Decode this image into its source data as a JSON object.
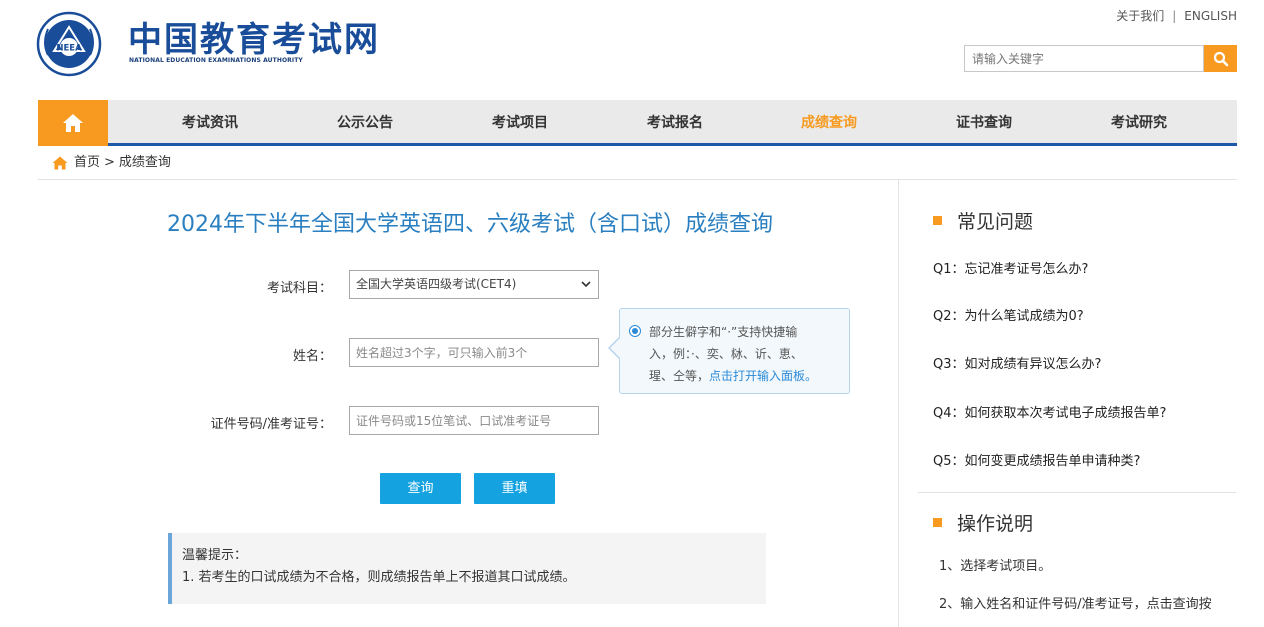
{
  "header": {
    "logo_text_cn": "中国教育考试网",
    "logo_text_en": "NATIONAL EDUCATION EXAMINATIONS AUTHORITY",
    "logo_emblem_text": "NEEA",
    "top_links": [
      "关于我们",
      "ENGLISH"
    ],
    "top_links_separator": "|",
    "search_placeholder": "请输入关键字"
  },
  "nav": {
    "items": [
      {
        "label": "考试资讯"
      },
      {
        "label": "公示公告"
      },
      {
        "label": "考试项目"
      },
      {
        "label": "考试报名"
      },
      {
        "label": "成绩查询",
        "active": true
      },
      {
        "label": "证书查询"
      },
      {
        "label": "考试研究"
      }
    ]
  },
  "breadcrumb": {
    "home": "首页",
    "separator": ">",
    "current": "成绩查询"
  },
  "main": {
    "title": "2024年下半年全国大学英语四、六级考试（含口试）成绩查询",
    "form": {
      "subject_label": "考试科目：",
      "subject_value": "全国大学英语四级考试(CET4)",
      "name_label": "姓名：",
      "name_placeholder": "姓名超过3个字，可只输入前3个",
      "id_label": "证件号码/准考证号：",
      "id_placeholder": "证件号码或15位笔试、口试准考证号",
      "query_button": "查询",
      "reset_button": "重填"
    },
    "tooltip": {
      "line1": "部分生僻字和“·”支持快捷输",
      "line2": "入，例：·、奕、栤、䜣、恵、",
      "line3": "瑆、仝等，",
      "link": "点击打开输入面板。"
    },
    "tips": {
      "heading": "温馨提示：",
      "item1": "1. 若考生的口试成绩为不合格，则成绩报告单上不报道其口试成绩。"
    }
  },
  "sidebar": {
    "faq_title": "常见问题",
    "faq": [
      "Q1：忘记准考证号怎么办?",
      "Q2：为什么笔试成绩为0?",
      "Q3：如对成绩有异议怎么办?",
      "Q4：如何获取本次考试电子成绩报告单?",
      "Q5：如何变更成绩报告单申请种类?"
    ],
    "howto_title": "操作说明",
    "howto": [
      "1、选择考试项目。",
      "2、输入姓名和证件号码/准考证号，点击查询按"
    ]
  },
  "colors": {
    "brand_blue": "#1a4d99",
    "accent_orange": "#f79a1f",
    "title_blue": "#2a7fc0",
    "button_blue": "#14a3e0"
  }
}
